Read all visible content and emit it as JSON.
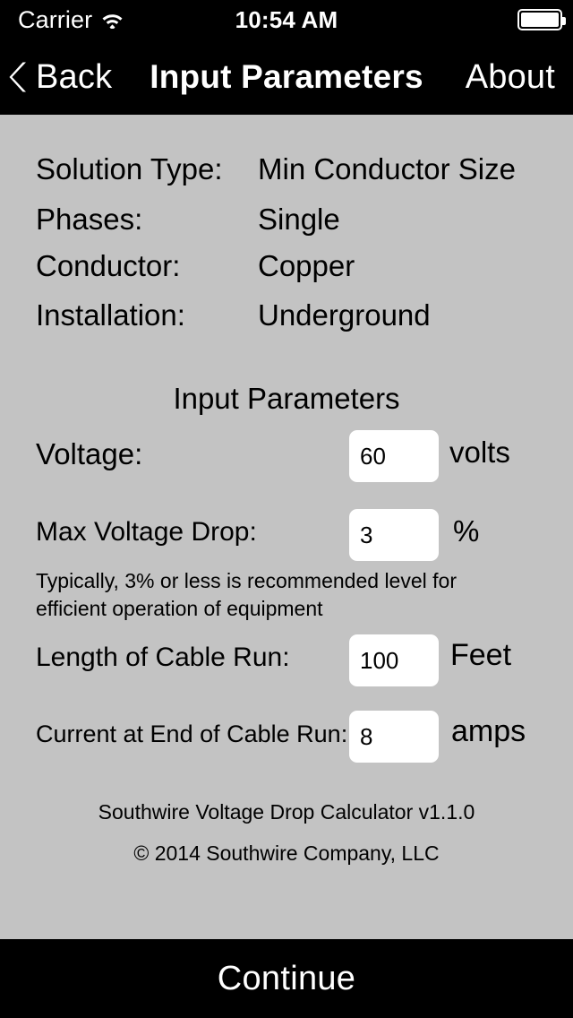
{
  "status_bar": {
    "carrier": "Carrier",
    "wifi_icon": "wifi-icon",
    "time": "10:54 AM",
    "battery_icon": "battery-full-icon"
  },
  "nav_bar": {
    "back_icon": "chevron-left-icon",
    "back_label": "Back",
    "title": "Input Parameters",
    "about_label": "About"
  },
  "summary": {
    "rows": [
      {
        "label": "Solution Type:",
        "value": "Min Conductor Size"
      },
      {
        "label": "Phases:",
        "value": "Single"
      },
      {
        "label": "Conductor:",
        "value": "Copper"
      },
      {
        "label": "Installation:",
        "value": "Underground"
      }
    ]
  },
  "form": {
    "heading": "Input Parameters",
    "fields": [
      {
        "label": "Voltage:",
        "value": "60",
        "unit": "volts"
      },
      {
        "label": "Max Voltage Drop:",
        "value": "3",
        "unit": "%"
      },
      {
        "label": "Length of Cable Run:",
        "value": "100",
        "unit": "Feet"
      },
      {
        "label": "Current at End of Cable Run:",
        "value": "8",
        "unit": "amps"
      }
    ],
    "hint": "Typically, 3% or less is recommended level for efficient operation of equipment"
  },
  "footer": {
    "version": "Southwire Voltage Drop Calculator v1.1.0",
    "copyright": "© 2014 Southwire Company, LLC"
  },
  "continue": {
    "label": "Continue"
  },
  "colors": {
    "background": "#c3c3c3",
    "bar_background": "#000000",
    "bar_text": "#ffffff",
    "field_background": "#ffffff",
    "text": "#000000"
  }
}
